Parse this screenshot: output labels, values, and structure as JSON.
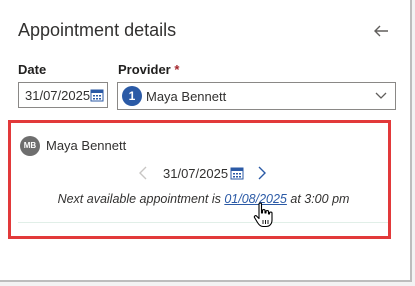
{
  "header": {
    "title": "Appointment details",
    "back_icon": "arrow-left-icon"
  },
  "form": {
    "date_label": "Date",
    "date_value": "31/07/2025",
    "provider_label": "Provider",
    "required_marker": "*",
    "provider_badge": "1",
    "provider_value": "Maya Bennett"
  },
  "schedule": {
    "avatar_initials": "MB",
    "provider_name": "Maya Bennett",
    "current_date": "31/07/2025",
    "next_prefix": "Next available appointment is ",
    "next_date": "01/08/2025",
    "next_suffix": " at 3:00 pm"
  },
  "colors": {
    "accent": "#2b5aa6",
    "highlight": "#e2393a",
    "required": "#a4262c"
  }
}
